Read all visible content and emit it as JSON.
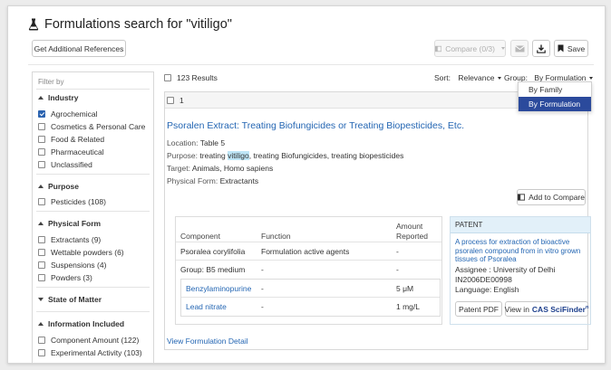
{
  "page": {
    "title": "Formulations search for \"vitiligo\""
  },
  "toolbar": {
    "get_refs": "Get Additional References",
    "compare": "Compare (0/3)",
    "save": "Save"
  },
  "filter": {
    "filter_by": "Filter by",
    "sections": {
      "industry": {
        "title": "Industry",
        "items": [
          {
            "label": "Agrochemical",
            "checked": true
          },
          {
            "label": "Cosmetics & Personal Care",
            "checked": false
          },
          {
            "label": "Food & Related",
            "checked": false
          },
          {
            "label": "Pharmaceutical",
            "checked": false
          },
          {
            "label": "Unclassified",
            "checked": false
          }
        ]
      },
      "purpose": {
        "title": "Purpose",
        "items": [
          {
            "label": "Pesticides (108)",
            "checked": false
          }
        ]
      },
      "physical_form": {
        "title": "Physical Form",
        "items": [
          {
            "label": "Extractants (9)",
            "checked": false
          },
          {
            "label": "Wettable powders (6)",
            "checked": false
          },
          {
            "label": "Suspensions (4)",
            "checked": false
          },
          {
            "label": "Powders (3)",
            "checked": false
          }
        ]
      },
      "state": {
        "title": "State of Matter"
      },
      "info": {
        "title": "Information Included",
        "items": [
          {
            "label": "Component Amount (122)",
            "checked": false
          },
          {
            "label": "Experimental Activity (103)",
            "checked": false
          }
        ]
      }
    }
  },
  "results": {
    "count": "123 Results",
    "sort_label": "Sort:",
    "sort_value": "Relevance",
    "group_label": "Group:",
    "group_value": "By Formulation",
    "group_options": [
      "By Family",
      "By Formulation"
    ]
  },
  "card": {
    "number": "1",
    "title": "Psoralen Extract: Treating Biofungicides or Treating Biopesticides, Etc.",
    "location_label": "Location:",
    "location_value": "Table 5",
    "purpose_label": "Purpose:",
    "purpose_pre": "treating",
    "purpose_hl": "vitiligo",
    "purpose_post": ", treating Biofungicides, treating biopesticides",
    "target_label": "Target:",
    "target_value": "Animals, Homo sapiens",
    "form_label": "Physical Form:",
    "form_value": "Extractants",
    "add_compare": "Add to Compare",
    "table": {
      "headers": [
        "Component",
        "Function",
        "Amount",
        "Reported"
      ],
      "rows": [
        {
          "component": "Psoralea corylifolia",
          "function": "Formulation active agents",
          "amount": "-"
        },
        {
          "component": "Group: B5 medium",
          "function": "-",
          "amount": "-"
        }
      ],
      "subrows": [
        {
          "component": "Benzylaminopurine",
          "function": "-",
          "amount": "5 μM"
        },
        {
          "component": "Lead nitrate",
          "function": "-",
          "amount": "1 mg/L"
        }
      ]
    },
    "patent": {
      "header": "PATENT",
      "title": "A process for extraction of bioactive psoralen compound from in vitro grown tissues of Psoralea",
      "assignee": "Assignee : University of Delhi",
      "number": "IN2006DE00998",
      "language": "Language: English",
      "pdf_button": "Patent PDF",
      "view_button_prefix": "View in",
      "view_button_brand": "CAS SciFinder",
      "view_button_suffix": "n"
    },
    "view_detail": "View Formulation Detail"
  },
  "colors": {
    "accent": "#2466b3",
    "selected": "#2b4a9c",
    "highlight": "#bfe6f7",
    "patent_header": "#e2f0f9"
  }
}
